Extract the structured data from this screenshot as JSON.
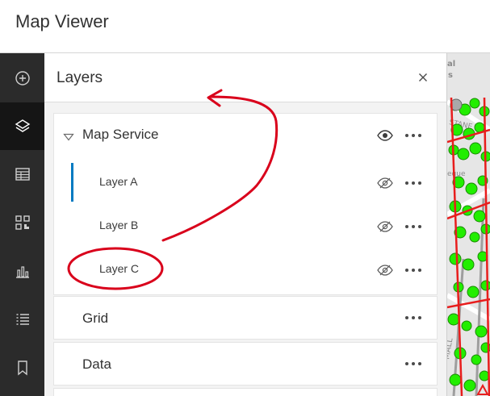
{
  "app": {
    "title": "Map Viewer"
  },
  "toolbar": {
    "items": [
      {
        "name": "add",
        "icon": "plus-circle-icon",
        "active": false
      },
      {
        "name": "layers",
        "icon": "layers-icon",
        "active": true
      },
      {
        "name": "table",
        "icon": "table-icon",
        "active": false
      },
      {
        "name": "qr",
        "icon": "qr-code-icon",
        "active": false
      },
      {
        "name": "charts",
        "icon": "bar-chart-icon",
        "active": false
      },
      {
        "name": "legend",
        "icon": "list-icon",
        "active": false
      },
      {
        "name": "bookmarks",
        "icon": "bookmark-icon",
        "active": false
      }
    ]
  },
  "panel": {
    "title": "Layers",
    "group": {
      "label": "Map Service",
      "visible": true,
      "sublayers": [
        {
          "label": "Layer A",
          "visible": false,
          "active": true
        },
        {
          "label": "Layer B",
          "visible": false,
          "active": false
        },
        {
          "label": "Layer C",
          "visible": false,
          "active": false
        }
      ]
    },
    "layers": [
      {
        "label": "Grid"
      },
      {
        "label": "Data"
      }
    ]
  },
  "map": {
    "label_fragments": [
      "al",
      "s",
      "STANE",
      "eque",
      "MALL"
    ]
  },
  "colors": {
    "accent": "#007ac2",
    "annotation": "#d9001b",
    "toolbar": "#2b2b2b",
    "point_fill": "#22ee00",
    "street": "#e81d1d"
  }
}
